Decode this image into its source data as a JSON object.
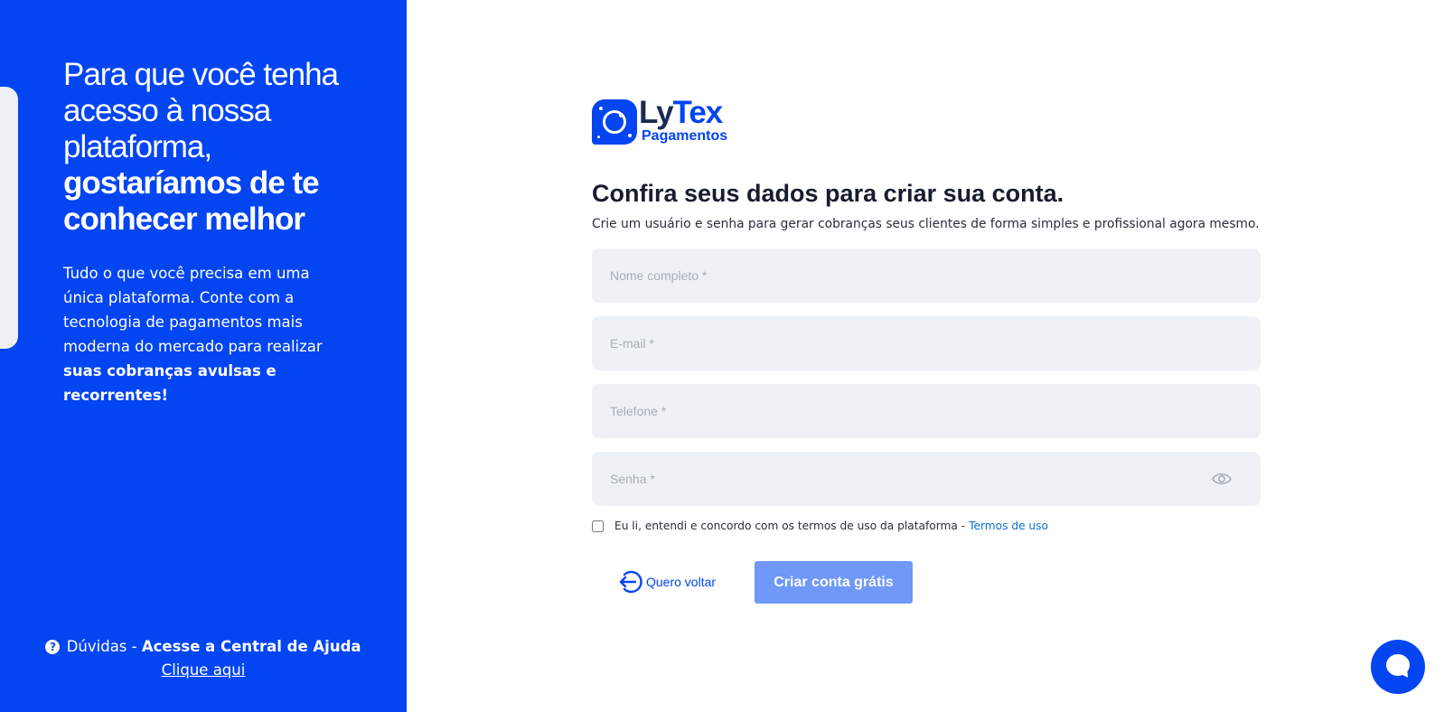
{
  "hero": {
    "title_part1": "Para que você tenha acesso à nossa plataforma,",
    "title_part2": "gostaríamos de te conhecer melhor",
    "text_part1": "Tudo o que você precisa em uma única plataforma. Conte com a tecnologia de pagamentos mais moderna do mercado para realizar",
    "text_part2": "suas cobranças avulsas e recorrentes!"
  },
  "help": {
    "icon": "question-circle-icon",
    "prefix": "Dúvidas -",
    "bold": "Acesse a Central de Ajuda",
    "link": "Clique aqui"
  },
  "logo": {
    "name_dark": "Ly",
    "name_accent": "Tex",
    "sub": "Pagamentos"
  },
  "form": {
    "title": "Confira seus dados para criar sua conta.",
    "subtitle": "Crie um usuário e senha para gerar cobranças seus clientes de forma simples e profissional agora mesmo.",
    "fields": {
      "name_placeholder": "Nome completo *",
      "email_placeholder": "E-mail *",
      "phone_placeholder": "Telefone *",
      "password_placeholder": "Senha *"
    },
    "terms_text": "Eu li, entendi e concordo com os termos de uso da plataforma -",
    "terms_link": "Termos de uso",
    "back_label": "Quero voltar",
    "submit_label": "Criar conta grátis"
  },
  "colors": {
    "brand_blue": "#0445f2",
    "button_disabled": "#6f98f7",
    "field_bg": "#eef2f6"
  },
  "icons": [
    "question-circle-icon",
    "eye-icon",
    "back-arrow-icon",
    "chat-icon"
  ]
}
